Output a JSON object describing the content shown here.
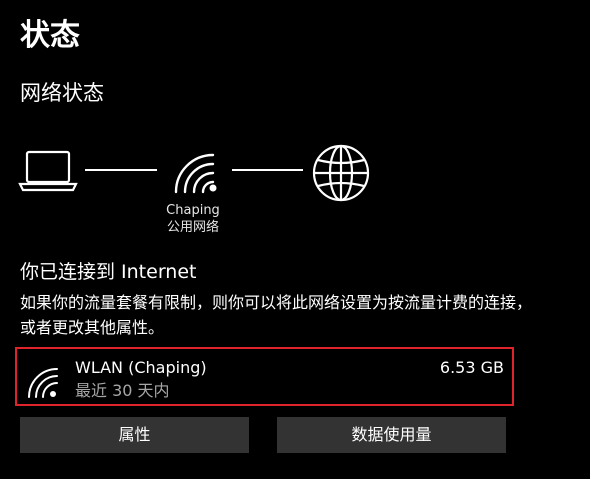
{
  "page": {
    "title": "状态"
  },
  "network_status": {
    "heading": "网络状态",
    "network_name": "Chaping",
    "network_type": "公用网络",
    "icons": [
      "laptop-icon",
      "wifi-icon",
      "globe-icon"
    ]
  },
  "connection": {
    "heading": "你已连接到 Internet",
    "description": "如果你的流量套餐有限制，则你可以将此网络设置为按流量计费的连接，或者更改其他属性。"
  },
  "wlan": {
    "name": "WLAN (Chaping)",
    "period": "最近 30 天内",
    "usage": "6.53 GB",
    "highlight_color": "#e0242b"
  },
  "buttons": {
    "properties": "属性",
    "data_usage": "数据使用量"
  }
}
